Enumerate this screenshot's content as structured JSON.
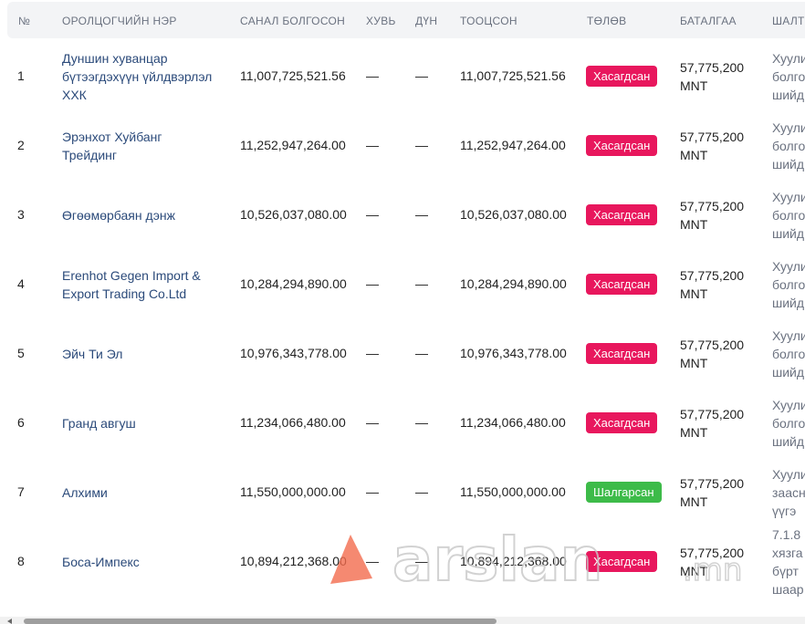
{
  "headers": {
    "no": "№",
    "participant": "ОРОЛЦОГЧИЙН НЭР",
    "offer": "САНАЛ БОЛГОСОН",
    "percent": "ХУВЬ",
    "amount": "ДҮН",
    "calculated": "ТООЦСОН",
    "status": "ТӨЛӨВ",
    "guarantee": "БАТАЛГАА",
    "reason": "ШАЛТ"
  },
  "rows": [
    {
      "no": "1",
      "name_lines": [
        "Дуншин хуванцар",
        "бүтээгдэхүүн үйлдвэрлэл",
        "ХХК"
      ],
      "offer": "11,007,725,521.56",
      "percent": "—",
      "amount": "—",
      "calculated": "11,007,725,521.56",
      "status": "Хасагдсан",
      "status_type": "rejected",
      "guarantee_lines": [
        "57,775,200",
        "MNT"
      ],
      "reason_lines": [
        "Хуули",
        "болго",
        "шийд"
      ]
    },
    {
      "no": "2",
      "name_lines": [
        "Эрэнхот Хуйбанг",
        "Трейдинг"
      ],
      "offer": "11,252,947,264.00",
      "percent": "—",
      "amount": "—",
      "calculated": "11,252,947,264.00",
      "status": "Хасагдсан",
      "status_type": "rejected",
      "guarantee_lines": [
        "57,775,200",
        "MNT"
      ],
      "reason_lines": [
        "Хуули",
        "болго",
        "шийд"
      ]
    },
    {
      "no": "3",
      "name_lines": [
        "Өгөөмөрбаян дэнж"
      ],
      "offer": "10,526,037,080.00",
      "percent": "—",
      "amount": "—",
      "calculated": "10,526,037,080.00",
      "status": "Хасагдсан",
      "status_type": "rejected",
      "guarantee_lines": [
        "57,775,200",
        "MNT"
      ],
      "reason_lines": [
        "Хуули",
        "болго",
        "шийд"
      ]
    },
    {
      "no": "4",
      "name_lines": [
        "Erenhot Gegen Import &",
        "Export Trading Co.Ltd"
      ],
      "offer": "10,284,294,890.00",
      "percent": "—",
      "amount": "—",
      "calculated": "10,284,294,890.00",
      "status": "Хасагдсан",
      "status_type": "rejected",
      "guarantee_lines": [
        "57,775,200",
        "MNT"
      ],
      "reason_lines": [
        "Хуули",
        "болго",
        "шийд"
      ]
    },
    {
      "no": "5",
      "name_lines": [
        "Эйч Ти Эл"
      ],
      "offer": "10,976,343,778.00",
      "percent": "—",
      "amount": "—",
      "calculated": "10,976,343,778.00",
      "status": "Хасагдсан",
      "status_type": "rejected",
      "guarantee_lines": [
        "57,775,200",
        "MNT"
      ],
      "reason_lines": [
        "Хуули",
        "болго",
        "шийд"
      ]
    },
    {
      "no": "6",
      "name_lines": [
        "Гранд авгуш"
      ],
      "offer": "11,234,066,480.00",
      "percent": "—",
      "amount": "—",
      "calculated": "11,234,066,480.00",
      "status": "Хасагдсан",
      "status_type": "rejected",
      "guarantee_lines": [
        "57,775,200",
        "MNT"
      ],
      "reason_lines": [
        "Хуули",
        "болго",
        "шийд"
      ]
    },
    {
      "no": "7",
      "name_lines": [
        "Алхими"
      ],
      "offer": "11,550,000,000.00",
      "percent": "—",
      "amount": "—",
      "calculated": "11,550,000,000.00",
      "status": "Шалгарсан",
      "status_type": "selected",
      "guarantee_lines": [
        "57,775,200",
        "MNT"
      ],
      "reason_lines": [
        "Хуули",
        "заасн",
        "үүгэ"
      ]
    },
    {
      "no": "8",
      "name_lines": [
        "Боса-Импекс"
      ],
      "offer": "10,894,212,368.00",
      "percent": "—",
      "amount": "—",
      "calculated": "10,894,212,368.00",
      "status": "Хасагдсан",
      "status_type": "rejected",
      "guarantee_lines": [
        "57,775,200",
        "MNT"
      ],
      "reason_lines": [
        "7.1.8",
        "хязга",
        "бүрт",
        "шаар"
      ]
    }
  ],
  "colors": {
    "rejected": "#e8175d",
    "selected": "#3dbb49",
    "link": "#2b4a7a"
  },
  "watermark": {
    "text": "arslan",
    "suffix": ".mn"
  }
}
